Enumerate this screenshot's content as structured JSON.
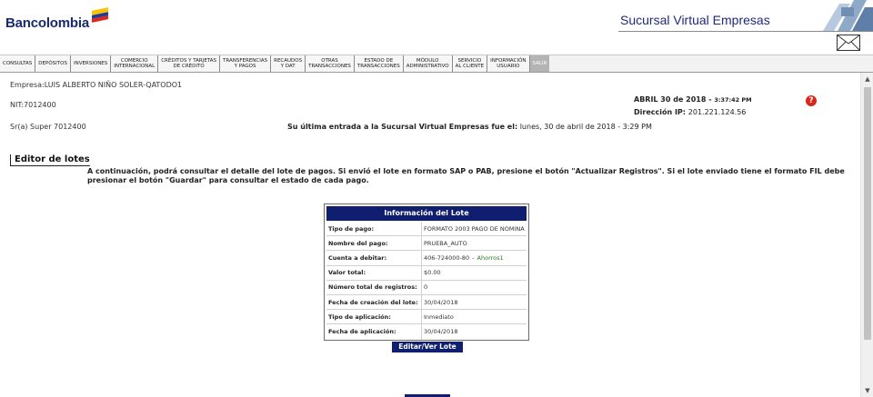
{
  "header": {
    "logo_text": "Bancolombia",
    "site_title": "Sucursal Virtual Empresas"
  },
  "nav": {
    "items": [
      {
        "label": "CONSULTAS"
      },
      {
        "label": "DEPÓSITOS"
      },
      {
        "label": "INVERSIONES"
      },
      {
        "label": "COMERCIO\nINTERNACIONAL"
      },
      {
        "label": "CRÉDITOS Y TARJETAS\nDE CRÉDITO"
      },
      {
        "label": "TRANSFERENCIAS\nY PAGOS"
      },
      {
        "label": "RECAUDOS\nY DAT"
      },
      {
        "label": "OTRAS\nTRANSACCIONES"
      },
      {
        "label": "ESTADO DE\nTRANSACCIONES"
      },
      {
        "label": "MÓDULO\nADMINISTRATIVO"
      },
      {
        "label": "SERVICIO\nAL CLIENTE"
      },
      {
        "label": "INFORMACIÓN\nUSUARIO"
      },
      {
        "label": "SALIR"
      }
    ]
  },
  "session": {
    "empresa": "Empresa:LUIS ALBERTO NIÑO SOLER-QATODO1",
    "nit": "NIT:7012400",
    "user": "Sr(a) Super 7012400",
    "date": "ABRIL 30 de 2018 - ",
    "time": "3:37:42 PM",
    "ip_label": "Dirección IP: ",
    "ip": "201.221.124.56",
    "last_entry_label": "Su última entrada a la Sucursal Virtual Empresas fue el:",
    "last_entry_value": " lunes, 30 de abril de 2018 - 3:29 PM",
    "help": "?"
  },
  "section": {
    "title": "Editor de lotes",
    "description": "A continuación, podrá consultar el detalle del lote de pagos. Si envió el lote en formato SAP o PAB, presione el botón \"Actualizar Registros\". Si el lote enviado tiene el formato FIL debe presionar el botón \"Guardar\" para consultar el estado de cada pago."
  },
  "info": {
    "title": "Información del Lote",
    "rows": [
      {
        "label": "Tipo de pago:",
        "value": "FORMATO 2003 PAGO DE NOMINA"
      },
      {
        "label": "Nombre del pago:",
        "value": "PRUEBA_AUTO"
      },
      {
        "label": "Cuenta a debitar:",
        "value": "406-724000-80",
        "dash": "-",
        "account_type": "Ahorros1"
      },
      {
        "label": "Valor total:",
        "value": "$0.00"
      },
      {
        "label": "Número total de registros:",
        "value": "0"
      },
      {
        "label": "Fecha de creación del lote:",
        "value": "30/04/2018"
      },
      {
        "label": "Tipo de aplicación:",
        "value": "Inmediato"
      },
      {
        "label": "Fecha de aplicación:",
        "value": "30/04/2018"
      }
    ]
  },
  "buttons": {
    "edit_view": "Editar/Ver Lote"
  },
  "scrollbar": {
    "up": "▲",
    "down": "▼"
  },
  "colors": {
    "primary_dark_blue": "#0f1e6e",
    "title_blue": "#1e2a7a",
    "help_red": "#d9251c",
    "account_green": "#2a7a2a"
  }
}
